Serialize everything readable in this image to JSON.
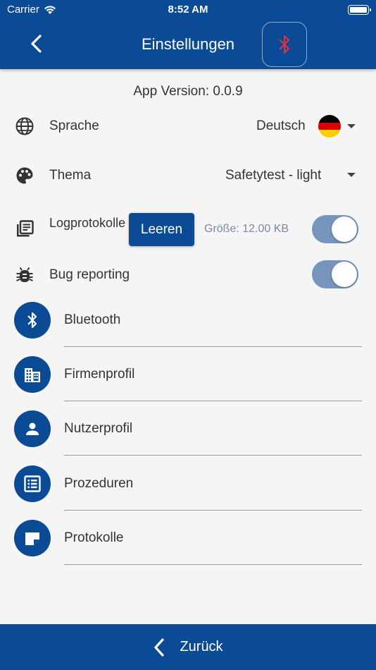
{
  "status_bar": {
    "carrier": "Carrier",
    "time": "8:52 AM"
  },
  "header": {
    "title": "Einstellungen",
    "back_icon": "chevron-left-icon",
    "bt_icon": "bluetooth-disconnected-icon"
  },
  "version_text": "App Version: 0.0.9",
  "language": {
    "label": "Sprache",
    "value": "Deutsch",
    "icon": "globe-icon"
  },
  "theme": {
    "label": "Thema",
    "value": "Safetytest - light",
    "icon": "palette-icon"
  },
  "logs": {
    "label": "Logprotokolle",
    "clear_label": "Leeren",
    "size_text": "Größe: 12.00 KB",
    "toggle_on": true,
    "icon": "log-icon"
  },
  "bug_reporting": {
    "label": "Bug reporting",
    "toggle_on": true,
    "icon": "bug-icon"
  },
  "menu": [
    {
      "label": "Bluetooth",
      "icon": "bluetooth-icon"
    },
    {
      "label": "Firmenprofil",
      "icon": "building-icon"
    },
    {
      "label": "Nutzerprofil",
      "icon": "person-icon"
    },
    {
      "label": "Prozeduren",
      "icon": "list-icon"
    },
    {
      "label": "Protokolle",
      "icon": "note-icon"
    }
  ],
  "footer": {
    "back_label": "Zurück"
  },
  "colors": {
    "primary": "#0b4a94",
    "toggle": "#7694bd",
    "bt_warning": "#d9334a"
  }
}
